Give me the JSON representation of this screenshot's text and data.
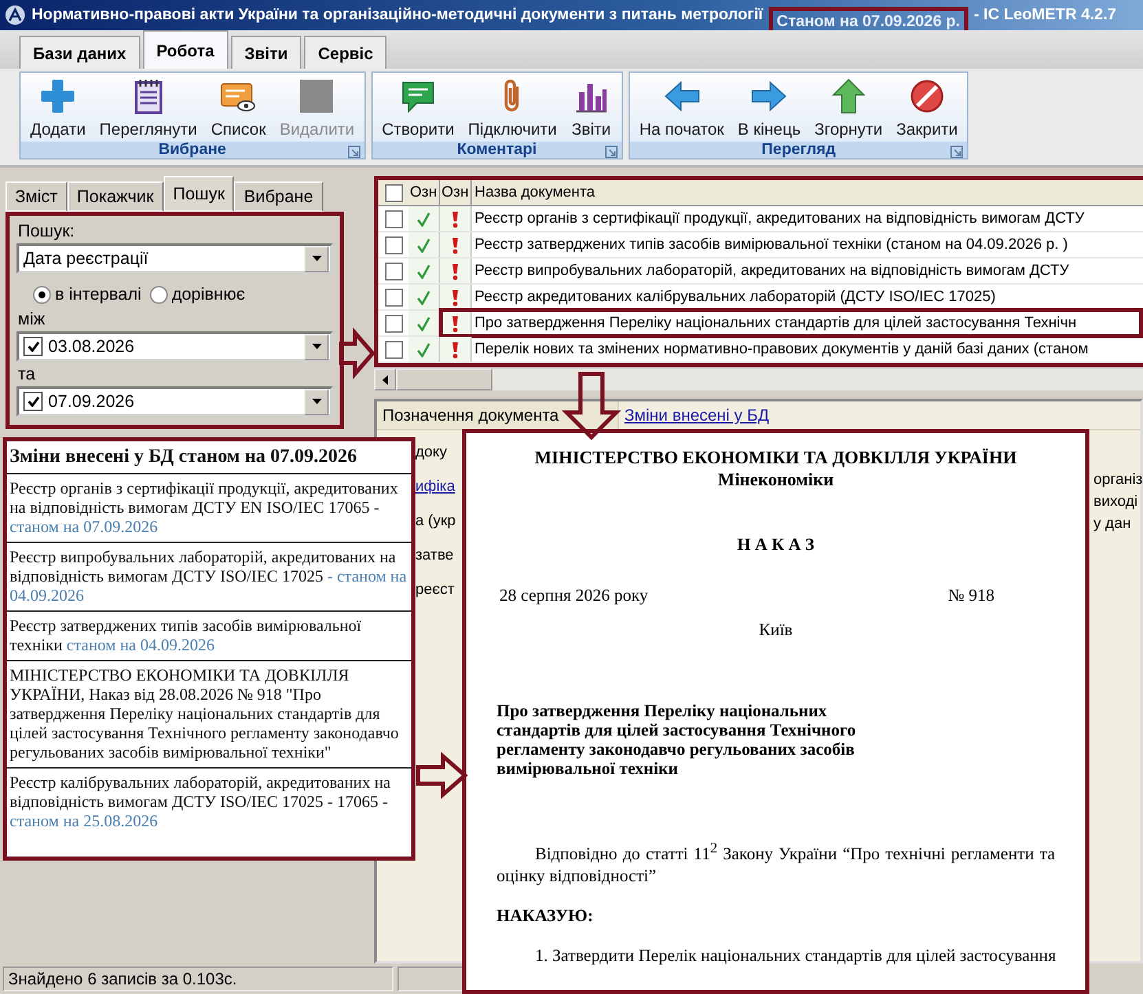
{
  "window": {
    "title": "Нормативно-правові акти України та організаційно-методичні документи з питань метрології",
    "status_note": "Станом на 07.09.2026 р.",
    "app": "- ІС LeoMETR 4.2.7"
  },
  "ribbon": {
    "tabs": [
      {
        "label": "Бази даних",
        "selected": false
      },
      {
        "label": "Робота",
        "selected": true
      },
      {
        "label": "Звіти",
        "selected": false
      },
      {
        "label": "Сервіс",
        "selected": false
      }
    ],
    "groups": [
      {
        "title": "Вибране",
        "buttons": [
          {
            "label": "Додати",
            "disabled": false
          },
          {
            "label": "Переглянути",
            "disabled": false
          },
          {
            "label": "Список",
            "disabled": false
          },
          {
            "label": "Видалити",
            "disabled": true
          }
        ]
      },
      {
        "title": "Коментарі",
        "buttons": [
          {
            "label": "Створити",
            "disabled": false
          },
          {
            "label": "Підключити",
            "disabled": false
          },
          {
            "label": "Звіти",
            "disabled": false
          }
        ]
      },
      {
        "title": "Перегляд",
        "buttons": [
          {
            "label": "На початок",
            "disabled": false
          },
          {
            "label": "В кінець",
            "disabled": false
          },
          {
            "label": "Згорнути",
            "disabled": false
          },
          {
            "label": "Закрити",
            "disabled": false
          }
        ]
      }
    ]
  },
  "left_tabs": [
    {
      "label": "Зміст",
      "selected": false
    },
    {
      "label": "Покажчик",
      "selected": false
    },
    {
      "label": "Пошук",
      "selected": true
    },
    {
      "label": "Вибране",
      "selected": false
    }
  ],
  "search": {
    "label": "Пошук:",
    "field": "Дата реєстрації",
    "modes": [
      {
        "label": "в інтервалі",
        "selected": true
      },
      {
        "label": "дорівнює",
        "selected": false
      }
    ],
    "ranges": [
      {
        "label": "між",
        "checked": true,
        "value": "03.08.2026"
      },
      {
        "label": "та",
        "checked": true,
        "value": "07.09.2026"
      }
    ]
  },
  "grid": {
    "header_checked": false,
    "columns": [
      "Озн",
      "Озн",
      "Назва документа"
    ],
    "rows": [
      {
        "checked": false,
        "highlighted": false,
        "title": "Реєстр органів з сертифікації продукції, акредитованих на відповідність вимогам ДСТУ"
      },
      {
        "checked": false,
        "highlighted": false,
        "title": "Реєстр затверджених типів засобів вимірювальної техніки  (станом на 04.09.2026 р. )"
      },
      {
        "checked": false,
        "highlighted": false,
        "title": "Реєстр випробувальних лабораторій, акредитованих на відповідність вимогам ДСТУ"
      },
      {
        "checked": false,
        "highlighted": false,
        "title": "Реєстр акредитованих калібрувальних лабораторій (ДСТУ ISO/IEC 17025)"
      },
      {
        "checked": false,
        "highlighted": true,
        "title": "Про затвердження Переліку національних стандартів для цілей застосування Технічн"
      },
      {
        "checked": false,
        "highlighted": false,
        "title": "Перелік нових та змінених нормативно-правових документів у даній базі даних (станом"
      }
    ]
  },
  "details": {
    "label": "Позначення документа",
    "value": "Зміни внесені у БД",
    "left_fragments": [
      {
        "text": "доку",
        "kind": "text"
      },
      {
        "text": "ифіка",
        "kind": "link"
      },
      {
        "text": "а (укр",
        "kind": "text"
      },
      {
        "text": "затве",
        "kind": "text"
      },
      {
        "text": "реєст",
        "kind": "text"
      }
    ],
    "right_fragments": [
      "організ",
      "виході",
      "у дан"
    ]
  },
  "changes": {
    "title": "Зміни внесені у БД станом на 07.09.2026",
    "items": [
      {
        "text": "Реєстр органів з сертифікації продукції, акредитованих на відповідність вимогам ДСТУ EN ISO/IEC 17065 -",
        "note": "станом на 07.09.2026"
      },
      {
        "text": "Реєстр випробувальних лабораторій, акредитованих на відповідність вимогам ДСТУ ISO/IEC 17025",
        "note": "- станом на 04.09.2026"
      },
      {
        "text": "Реєстр затверджених типів засобів вимірювальної техніки",
        "note": "станом на 04.09.2026"
      },
      {
        "text": "МІНІСТЕРСТВО ЕКОНОМІКИ ТА ДОВКІЛЛЯ УКРАЇНИ, Наказ від 28.08.2026 № 918 \"Про затвердження Переліку національних стандартів для цілей застосування Технічного регламенту законодавчо регульованих засобів вимірювальної техніки\""
      },
      {
        "text": "Реєстр калібрувальних лабораторій, акредитованих на відповідність вимогам ДСТУ ISO/IEC 17025 - 17065 -",
        "note": "станом на 25.08.2026"
      }
    ]
  },
  "document": {
    "ministry": "МІНІСТЕРСТВО ЕКОНОМІКИ ТА ДОВКІЛЛЯ УКРАЇНИ",
    "short_name": "Мінекономіки",
    "doc_type": "Н А К А З",
    "date": "28 серпня 2026 року",
    "number": "№ 918",
    "city": "Київ",
    "title": "Про затвердження Переліку національних стандартів для цілей застосування Технічного регламенту законодавчо регульованих засобів вимірювальної техніки",
    "preamble": "Відповідно до статті 11$^{2}$ Закону України “Про технічні регламенти та оцінку відповідності”",
    "order_word": "НАКАЗУЮ:",
    "clause": "1. Затвердити Перелік національних стандартів для цілей застосування"
  },
  "status_bar": "Знайдено 6 записів за 0.103с."
}
